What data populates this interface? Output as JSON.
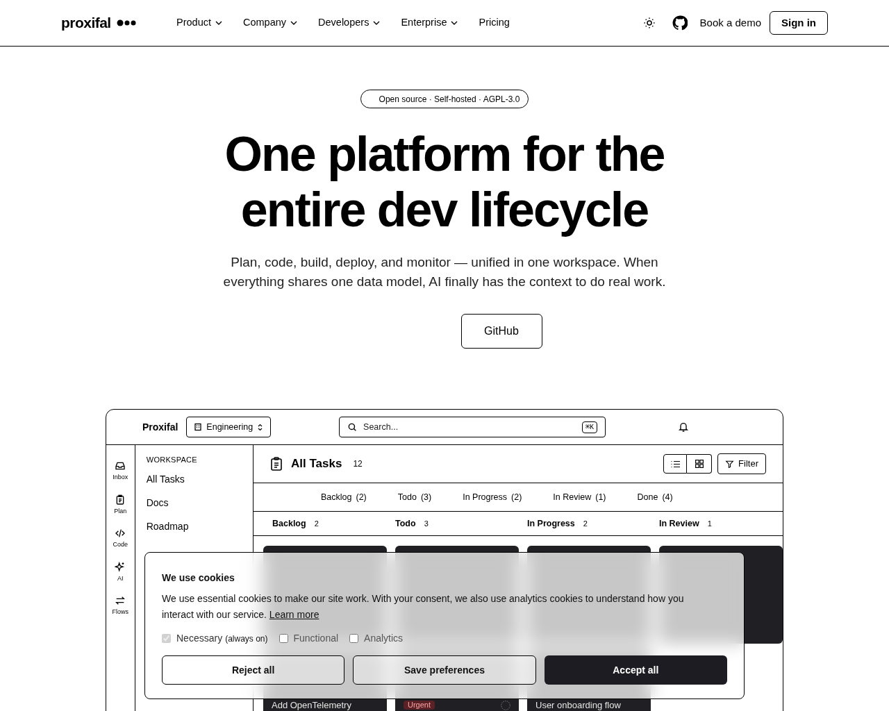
{
  "nav": {
    "logo": "proxifal",
    "links": [
      {
        "label": "Product",
        "dropdown": true
      },
      {
        "label": "Company",
        "dropdown": true
      },
      {
        "label": "Developers",
        "dropdown": true
      },
      {
        "label": "Enterprise",
        "dropdown": true
      },
      {
        "label": "Pricing",
        "dropdown": false
      }
    ],
    "demo": "Book a demo",
    "signin": "Sign in"
  },
  "hero": {
    "badge": "Open source · Self-hosted · AGPL-3.0",
    "title_lines": [
      "One platform for the",
      "entire dev lifecycle"
    ],
    "subtitle": "Plan, code, build, deploy, and monitor — unified in one workspace. When everything shares one data model, AI finally has the context to do real work.",
    "button": "GitHub"
  },
  "app": {
    "brand": "Proxifal",
    "workspace": "Engineering",
    "search_placeholder": "Search...",
    "shortcut": "⌘K",
    "rail": [
      {
        "label": "Inbox"
      },
      {
        "label": "Plan"
      },
      {
        "label": "Code"
      },
      {
        "label": "AI"
      },
      {
        "label": "Flows"
      }
    ],
    "sidebar": {
      "heading": "WORKSPACE",
      "items": [
        "All Tasks",
        "Docs",
        "Roadmap"
      ]
    },
    "title": "All Tasks",
    "count": "12",
    "filter": "Filter",
    "status_tabs": [
      {
        "label": "Backlog",
        "count": "(2)"
      },
      {
        "label": "Todo",
        "count": "(3)"
      },
      {
        "label": "In Progress",
        "count": "(2)"
      },
      {
        "label": "In Review",
        "count": "(1)"
      },
      {
        "label": "Done",
        "count": "(4)"
      }
    ],
    "columns": [
      {
        "name": "Backlog",
        "count": "2"
      },
      {
        "name": "Todo",
        "count": "3"
      },
      {
        "name": "In Progress",
        "count": "2"
      },
      {
        "name": "In Review",
        "count": "1"
      }
    ],
    "bottom_cards": [
      {
        "title": "Add OpenTelemetry",
        "avatar": false
      },
      {
        "badge": "Urgent",
        "avatar": true
      },
      {
        "title": "User onboarding flow",
        "avatar": false
      }
    ]
  },
  "cookies": {
    "title": "We use cookies",
    "text": "We use essential cookies to make our site work. With your consent, we also use analytics cookies to understand how you interact with our service.",
    "link": "Learn more",
    "options": [
      {
        "label": "Necessary",
        "note": "(always on)",
        "checked": true,
        "disabled": true
      },
      {
        "label": "Functional",
        "checked": false,
        "disabled": false
      },
      {
        "label": "Analytics",
        "checked": false,
        "disabled": false
      }
    ],
    "buttons": [
      {
        "label": "Reject all",
        "kind": "outline"
      },
      {
        "label": "Save preferences",
        "kind": "outline"
      },
      {
        "label": "Accept all",
        "kind": "primary"
      }
    ]
  }
}
